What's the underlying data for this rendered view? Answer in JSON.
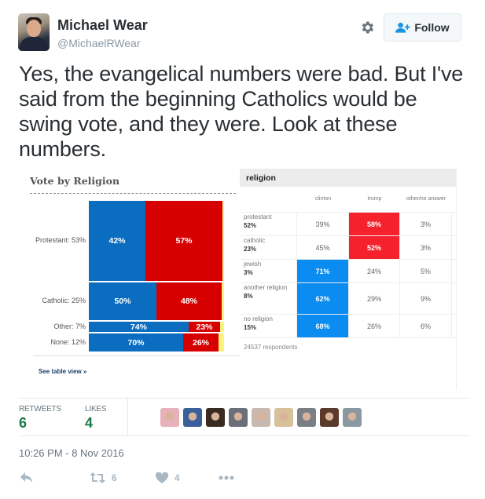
{
  "user": {
    "name": "Michael Wear",
    "handle": "@MichaelRWear"
  },
  "header": {
    "follow_label": "Follow"
  },
  "tweet": {
    "text": "Yes, the evangelical numbers were bad. But I've said from the beginning Catholics would be swing vote, and they were. Look at these numbers."
  },
  "media": {
    "chart": {
      "title": "Vote by Religion",
      "see_table": "See table view »"
    },
    "table": {
      "title": "religion",
      "columns": [
        "",
        "clinton",
        "trump",
        "other/no answer"
      ],
      "rows": [
        {
          "label": "protestant",
          "share": "52%",
          "clinton": "39%",
          "trump": "58%",
          "other": "3%",
          "winner": "trump"
        },
        {
          "label": "catholic",
          "share": "23%",
          "clinton": "45%",
          "trump": "52%",
          "other": "3%",
          "winner": "trump"
        },
        {
          "label": "jewish",
          "share": "3%",
          "clinton": "71%",
          "trump": "24%",
          "other": "5%",
          "winner": "clinton"
        },
        {
          "label": "another religion",
          "share": "8%",
          "clinton": "62%",
          "trump": "29%",
          "other": "9%",
          "winner": "clinton"
        },
        {
          "label": "no religion",
          "share": "15%",
          "clinton": "68%",
          "trump": "26%",
          "other": "6%",
          "winner": "clinton"
        }
      ],
      "footer": "24537 respondents"
    }
  },
  "chart_data": {
    "type": "bar",
    "title": "Vote by Religion",
    "xlabel": "",
    "ylabel": "",
    "categories": [
      "Protestant: 53%",
      "Catholic: 25%",
      "Other: 7%",
      "None: 12%"
    ],
    "category_share": [
      53,
      25,
      7,
      12
    ],
    "series": [
      {
        "name": "Clinton",
        "color": "#0b6dc0",
        "values": [
          42,
          50,
          74,
          70
        ]
      },
      {
        "name": "Trump",
        "color": "#d60000",
        "values": [
          57,
          48,
          23,
          26
        ]
      },
      {
        "name": "Other",
        "color": "#fff27a",
        "values": [
          1,
          2,
          3,
          4
        ]
      }
    ],
    "stacked": true,
    "orientation": "horizontal",
    "note": "Marimekko-style: bar height proportional to category share"
  },
  "stats": {
    "retweets_label": "RETWEETS",
    "retweets": "6",
    "likes_label": "LIKES",
    "likes": "4",
    "liker_colors": [
      "#e8b0b8",
      "#3a5f9a",
      "#3a2b22",
      "#6a6f7a",
      "#c8b8b0",
      "#d8c09a",
      "#7a7f86",
      "#5a3a2a",
      "#8a98a2"
    ]
  },
  "timestamp": "10:26 PM - 8 Nov 2016",
  "actions": {
    "retweet_count": "6",
    "like_count": "4"
  },
  "colors": {
    "clinton": "#0b6dc0",
    "trump": "#d60000",
    "table_red": "#f5222d",
    "table_blue": "#0a8cf0",
    "count_green": "#1a7a4c"
  }
}
